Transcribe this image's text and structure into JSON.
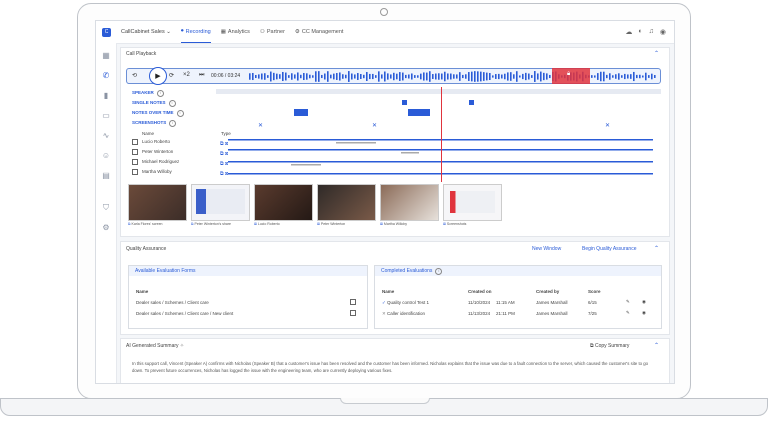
{
  "topbar": {
    "logo": "C",
    "app": "CallCabinet Sales ⌄",
    "tabs": [
      {
        "label": "Recording",
        "icon": "microphone-icon"
      },
      {
        "label": "Analytics",
        "icon": "chart-icon"
      },
      {
        "label": "Partner",
        "icon": "partner-icon"
      },
      {
        "label": "CC Management",
        "icon": "gear-icon"
      }
    ]
  },
  "playback": {
    "title": "Call Playback",
    "speed": "×2",
    "time": "00:06 / 03:24",
    "tracks": [
      "SPEAKER",
      "SINGLE NOTES",
      "NOTES OVER TIME",
      "SCREENSHOTS"
    ],
    "table_headers": [
      "Name",
      "Type"
    ],
    "people": [
      "Lucio Roberto",
      "Peter Winterton",
      "Michael Rodriguez",
      "Martha Willoby"
    ]
  },
  "thumbnails": [
    "Karla Flores' screen",
    "Peter Winterton's share",
    "Lucio Roberto",
    "Peter Winterton",
    "Martha Willoby",
    "Screenshots"
  ],
  "qa": {
    "title": "Quality Assurance",
    "new_window": "New Window",
    "begin": "Begin Quality Assurance",
    "forms_title": "Available Evaluation Forms",
    "forms_header": "Name",
    "forms": [
      "Dealer sales / Schemes / Client care",
      "Dealer sales / Schemes / Client care / New client"
    ],
    "completed_title": "Completed Evaluations",
    "completed_headers": [
      "Name",
      "Created on",
      "Created by",
      "Score"
    ],
    "completed": [
      {
        "name": "Quality control Test 1",
        "date": "11/10/2024",
        "time": "11:15 AM",
        "by": "James Marshall",
        "score": "6/15"
      },
      {
        "name": "Caller identification",
        "date": "11/13/2024",
        "time": "21:11 PM",
        "by": "James Marshall",
        "score": "7/25"
      }
    ]
  },
  "summary": {
    "title": "AI Generated Summary",
    "copy": "Copy Summary",
    "text": "In this support call, Vincent (Speaker A) confirms with Nicholas (Speaker B) that a customer's issue has been resolved and the customer has been informed. Nicholas explains that the issue was due to a fault connection to the server, which caused the customer's site to go down. To prevent future occurrences, Nicholas has logged the issue with the engineering team, who are currently deploying various fixes."
  },
  "colors": {
    "accent": "#2a5bd7",
    "alert": "#e0343d"
  }
}
